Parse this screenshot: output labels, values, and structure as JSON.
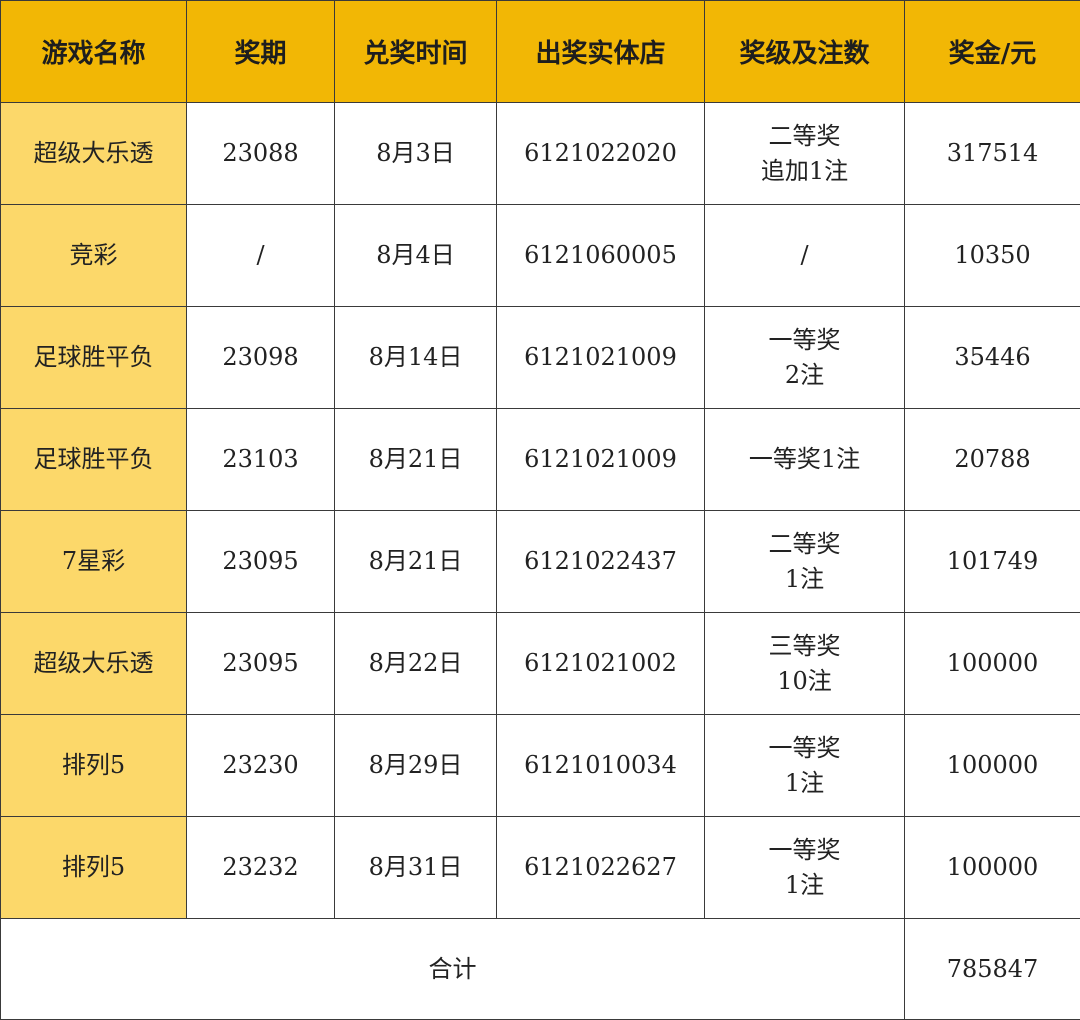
{
  "table": {
    "headers": [
      "游戏名称",
      "奖期",
      "兑奖时间",
      "出奖实体店",
      "奖级及注数",
      "奖金/元"
    ],
    "rows": [
      {
        "game": "超级大乐透",
        "period": "23088",
        "date": "8月3日",
        "store": "6121022020",
        "level": [
          "二等奖",
          "追加1注"
        ],
        "prize": "317514"
      },
      {
        "game": "竞彩",
        "period": "/",
        "date": "8月4日",
        "store": "6121060005",
        "level": [
          "/"
        ],
        "prize": "10350"
      },
      {
        "game": "足球胜平负",
        "period": "23098",
        "date": "8月14日",
        "store": "6121021009",
        "level": [
          "一等奖",
          "2注"
        ],
        "prize": "35446"
      },
      {
        "game": "足球胜平负",
        "period": "23103",
        "date": "8月21日",
        "store": "6121021009",
        "level": [
          "一等奖1注"
        ],
        "prize": "20788"
      },
      {
        "game": "7星彩",
        "period": "23095",
        "date": "8月21日",
        "store": "6121022437",
        "level": [
          "二等奖",
          "1注"
        ],
        "prize": "101749"
      },
      {
        "game": "超级大乐透",
        "period": "23095",
        "date": "8月22日",
        "store": "6121021002",
        "level": [
          "三等奖",
          "10注"
        ],
        "prize": "100000"
      },
      {
        "game": "排列5",
        "period": "23230",
        "date": "8月29日",
        "store": "6121010034",
        "level": [
          "一等奖",
          "1注"
        ],
        "prize": "100000"
      },
      {
        "game": "排列5",
        "period": "23232",
        "date": "8月31日",
        "store": "6121022627",
        "level": [
          "一等奖",
          "1注"
        ],
        "prize": "100000"
      }
    ],
    "total": {
      "label": "合计",
      "value": "785847"
    }
  },
  "colors": {
    "header_bg": "#f2b705",
    "game_cell_bg": "#fcd86a",
    "border": "#3a3a3a"
  }
}
